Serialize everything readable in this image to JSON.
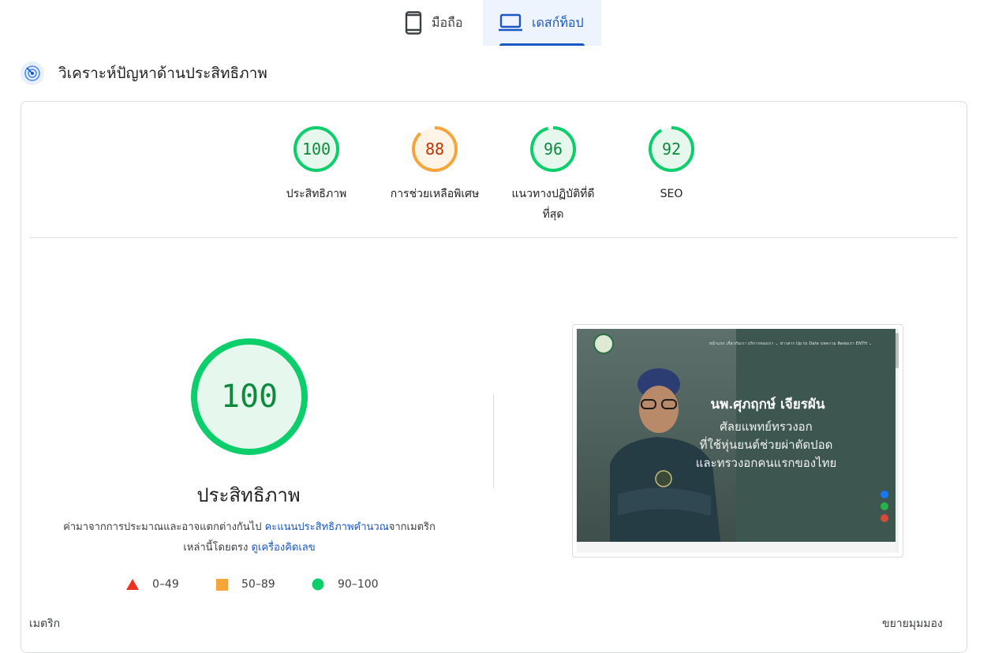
{
  "tabs": {
    "mobile": "มือถือ",
    "desktop": "เดสก์ท็อป",
    "active": "desktop"
  },
  "section": {
    "title": "วิเคราะห์ปัญหาด้านประสิทธิภาพ"
  },
  "scores": [
    {
      "value": "100",
      "label": "ประสิทธิภาพ",
      "fraction": 1.0,
      "status": "good"
    },
    {
      "value": "88",
      "label": "การช่วยเหลือพิเศษ",
      "fraction": 0.88,
      "status": "average"
    },
    {
      "value": "96",
      "label": "แนวทางปฏิบัติที่ดีที่สุด",
      "fraction": 0.96,
      "status": "good"
    },
    {
      "value": "92",
      "label": "SEO",
      "fraction": 0.92,
      "status": "good"
    }
  ],
  "main_score": {
    "value": "100",
    "title": "ประสิทธิภาพ",
    "desc_part1": "ค่ามาจากการประมาณและอาจแตกต่างกันไป ",
    "desc_link1": "คะแนนประสิทธิภาพคำนวณ",
    "desc_part2": "จากเมตริกเหล่านี้โดยตรง ",
    "desc_link2": "ดูเครื่องคิดเลข"
  },
  "legend": [
    {
      "range": "0–49",
      "shape": "triangle",
      "color": "#eb3323"
    },
    {
      "range": "50–89",
      "shape": "square",
      "color": "#f6a53b"
    },
    {
      "range": "90–100",
      "shape": "circle",
      "color": "#0cce6b"
    }
  ],
  "colors": {
    "good": "#0cce6b",
    "good_text": "#0d8a3e",
    "good_bg": "#e6f8ee",
    "average": "#f6a53b",
    "average_text": "#c33300",
    "average_bg": "#fff4e5",
    "accent": "#1a56c4"
  },
  "screenshot": {
    "nav": "หน้าแรก   เกี่ยวกับเรา   บริการของเรา ⌄   ข่าวสาร Up to Date   บทความ   ติดต่อเรา   ENTH ⌄",
    "name": "นพ.ศุภฤกษ์ เจียรผัน",
    "line1": "ศัลยแพทย์ทรวงอก",
    "line2": "ที่ใช้หุ่นยนต์ช่วยผ่าตัดปอด",
    "line3": "และทรวงอกคนแรกของไทย"
  },
  "footer": {
    "metrics": "เมตริก",
    "expand": "ขยายมุมมอง"
  }
}
